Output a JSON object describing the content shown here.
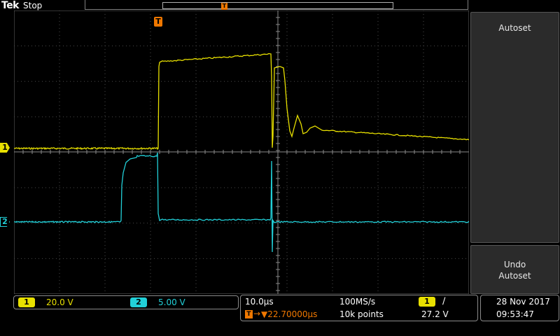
{
  "header": {
    "brand": "Tek",
    "run_state": "Stop",
    "trigger_marker": "T"
  },
  "side_menu": {
    "autoset_label": "Autoset",
    "undo_autoset_label": "Undo Autoset"
  },
  "channels": [
    {
      "number": "1",
      "scale": "20.0 V",
      "color": "#e8e000"
    },
    {
      "number": "2",
      "scale": "5.00 V",
      "color": "#22d0d8"
    }
  ],
  "timebase": {
    "horizontal_scale": "10.0µs",
    "trigger_position": "▼22.70000µs",
    "sample_rate": "100MS/s",
    "record_length": "10k points",
    "trigger_source": "1",
    "trigger_slope": "∕",
    "trigger_level": "27.2 V"
  },
  "datetime": {
    "date": "28 Nov 2017",
    "time": "09:53:47"
  },
  "colors": {
    "ch1": "#e8e000",
    "ch2": "#22d0d8",
    "trigger": "#f07800",
    "grid": "#555555"
  }
}
